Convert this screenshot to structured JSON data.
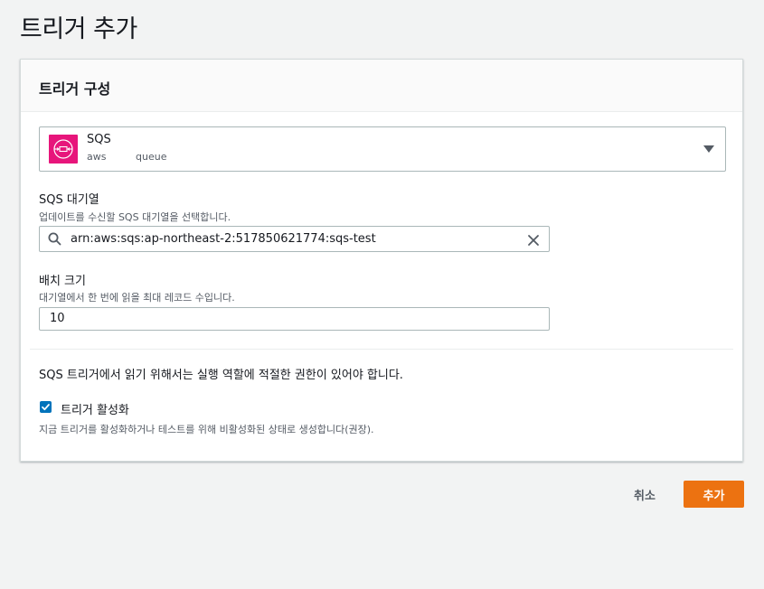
{
  "page": {
    "title": "트리거 추가"
  },
  "panel": {
    "header": "트리거 구성",
    "source": {
      "name": "SQS",
      "tags": [
        "aws",
        "queue"
      ],
      "icon": "sqs-service-icon",
      "icon_color": "#e7157b"
    },
    "queue_field": {
      "label": "SQS 대기열",
      "description": "업데이트를 수신할 SQS 대기열을 선택합니다.",
      "value": "arn:aws:sqs:ap-northeast-2:517850621774:sqs-test",
      "icon": "search-icon",
      "clear_icon": "close-icon"
    },
    "batch_field": {
      "label": "배치 크기",
      "description": "대기열에서 한 번에 읽을 최대 레코드 수입니다.",
      "value": "10"
    },
    "permission_info": "SQS 트리거에서 읽기 위해서는 실행 역할에 적절한 권한이 있어야 합니다.",
    "enable_trigger": {
      "label": "트리거 활성화",
      "checked": true,
      "description": "지금 트리거를 활성화하거나 테스트를 위해 비활성화된 상태로 생성합니다(권장).",
      "color": "#0073bb"
    }
  },
  "actions": {
    "cancel_label": "취소",
    "add_label": "추가",
    "add_color": "#ec7211"
  }
}
